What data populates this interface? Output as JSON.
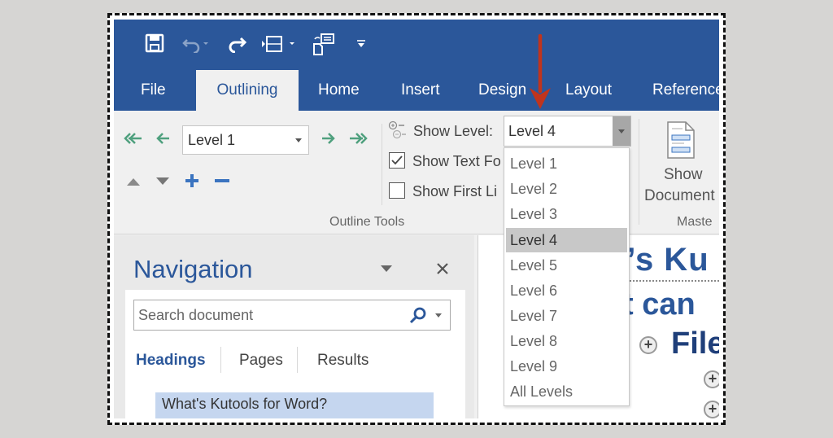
{
  "quick_access": {
    "icons": [
      "save-icon",
      "undo-icon",
      "redo-icon",
      "spacing-icon",
      "page-switch-icon",
      "customize-qat-icon"
    ]
  },
  "tabs": [
    {
      "label": "File",
      "active": false
    },
    {
      "label": "Outlining",
      "active": true
    },
    {
      "label": "Home",
      "active": false
    },
    {
      "label": "Insert",
      "active": false
    },
    {
      "label": "Design",
      "active": false
    },
    {
      "label": "Layout",
      "active": false
    },
    {
      "label": "Reference",
      "active": false
    }
  ],
  "ribbon": {
    "outline_level_value": "Level 1",
    "show_level_label": "Show Level:",
    "show_level_value": "Level 4",
    "show_text_formatting_label": "Show Text Fo",
    "show_text_formatting_checked": true,
    "show_first_line_label": "Show First Li",
    "show_first_line_checked": false,
    "outline_tools_group": "Outline Tools",
    "show_document_label_1": "Show",
    "show_document_label_2": "Document",
    "master_group": "Maste"
  },
  "show_level_dropdown": {
    "options": [
      "Level 1",
      "Level 2",
      "Level 3",
      "Level 4",
      "Level 5",
      "Level 6",
      "Level 7",
      "Level 8",
      "Level 9",
      "All Levels"
    ],
    "selected": "Level 4"
  },
  "navigation": {
    "title": "Navigation",
    "search_placeholder": "Search document",
    "tabs": [
      "Headings",
      "Pages",
      "Results"
    ],
    "active_tab": "Headings",
    "headings": [
      "What's Kutools for Word?"
    ]
  },
  "document": {
    "line1": "t’s Ku",
    "line2": "t can",
    "line3": "File"
  },
  "colors": {
    "ribbon_blue": "#2b579a",
    "annotation_arrow": "#c0341d",
    "heading_highlight": "#c5d6ef"
  }
}
